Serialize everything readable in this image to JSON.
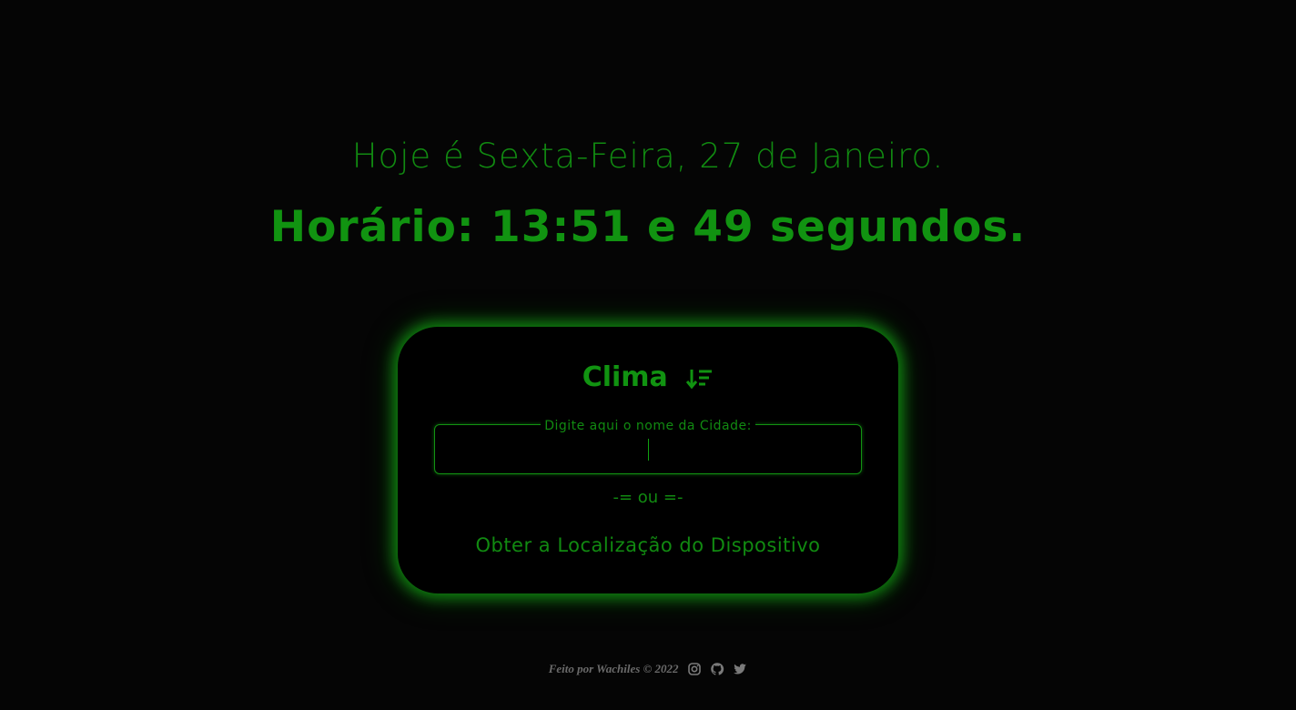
{
  "header": {
    "date_text": "Hoje é Sexta-Feira, 27 de Janeiro.",
    "time_text": "Horário: 13:51 e 49 segundos."
  },
  "weather_card": {
    "title": "Clima",
    "title_icon": "sort-down-icon",
    "city_field": {
      "legend": "Digite aqui o nome da Cidade:",
      "value": "",
      "placeholder": ""
    },
    "separator": "-= ou =-",
    "geolocation_button_label": "Obter a Localização do Dispositivo"
  },
  "footer": {
    "credit": "Feito por Wachiles © 2022",
    "social_icons": [
      "instagram-icon",
      "github-icon",
      "twitter-icon"
    ]
  },
  "colors": {
    "background": "#050505",
    "accent_green": "#119311",
    "glow_green": "#14a014",
    "footer_gray": "#6b6b6b"
  }
}
